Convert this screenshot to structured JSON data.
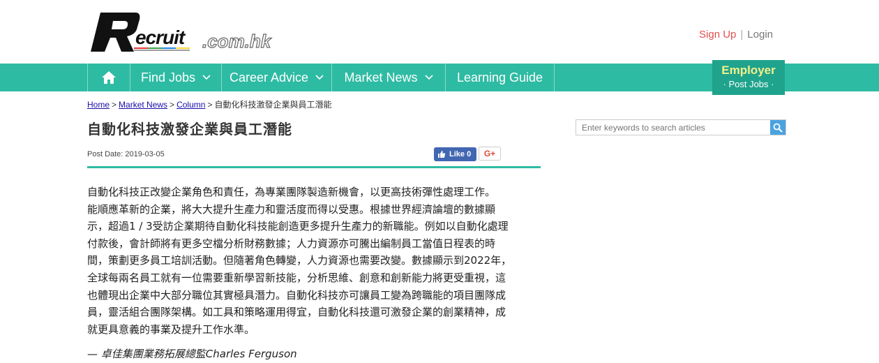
{
  "header": {
    "logo_word": "ecruit",
    "logo_domain": ".com.hk",
    "signup": "Sign Up",
    "separator": "|",
    "login": "Login"
  },
  "nav": {
    "home_icon": "home-icon",
    "items": [
      {
        "label": "Find Jobs"
      },
      {
        "label": "Career Advice"
      },
      {
        "label": "Market News"
      },
      {
        "label": "Learning Guide"
      }
    ],
    "employer_title": "Employer",
    "employer_sub": "· Post Jobs ·",
    "accent_color": "#2ebba3"
  },
  "breadcrumb": {
    "home": "Home",
    "market_news": "Market News",
    "column": "Column",
    "current": "自動化科技激發企業與員工潛能",
    "sep": ">"
  },
  "article": {
    "title": "自動化科技激發企業與員工潛能",
    "post_date": "Post Date: 2019-03-05",
    "like_label": "Like 0",
    "gplus_label": "G+",
    "lines": [
      "自動化科技正改變企業角色和責任，為專業團隊製造新機會，以更高技術彈性處理工作。",
      "能順應革新的企業，將大大提升生產力和靈活度而得以受惠。根據世界經濟論壇的數據顯",
      "示，超過1 / 3受訪企業期待自動化科技能創造更多提升生產力的新職能。例如以自動化處理",
      "付款後，會計師將有更多空檔分析財務數據；人力資源亦可騰出編制員工當值日程表的時",
      "間，策劃更多員工培訓活動。但隨著角色轉變，人力資源也需要改變。數據顯示到2022年，",
      "全球每兩名員工就有一位需要重新學習新技能，分析思維、創意和創新能力將更受重視，這",
      "也體現出企業中大部分職位其實極具潛力。自動化科技亦可讓員工變為跨職能的項目團隊成",
      "員，靈活組合團隊架構。如工具和策略運用得宜，自動化科技還可激發企業的創業精神，成",
      "就更具意義的事業及提升工作水準。"
    ],
    "quote": "— 卓佳集團業務拓展總監Charles Ferguson"
  },
  "search": {
    "placeholder": "Enter keywords to search articles"
  }
}
